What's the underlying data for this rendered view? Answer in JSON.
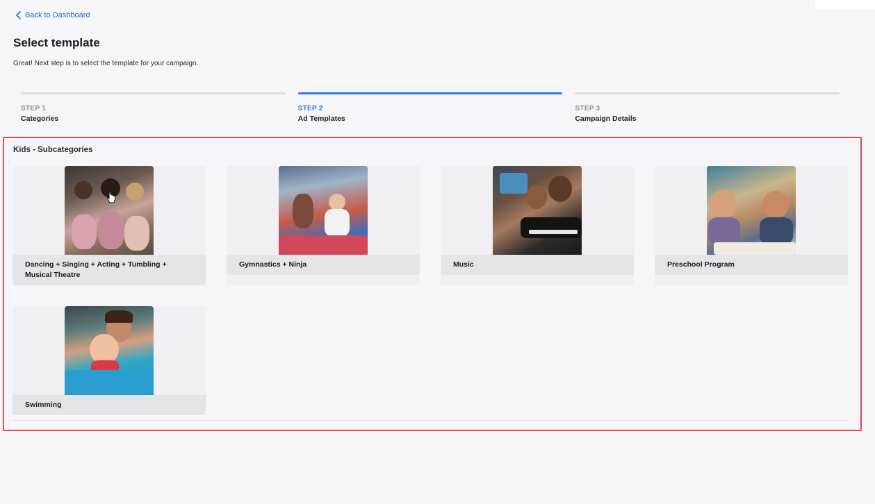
{
  "nav": {
    "back_label": "Back to Dashboard"
  },
  "header": {
    "title": "Select template",
    "subtitle": "Great! Next step is to select the template for your campaign."
  },
  "steps": [
    {
      "number": "STEP 1",
      "name": "Categories",
      "active": false
    },
    {
      "number": "STEP 2",
      "name": "Ad Templates",
      "active": true
    },
    {
      "number": "STEP 3",
      "name": "Campaign Details",
      "active": false
    }
  ],
  "section": {
    "title": "Kids - Subcategories",
    "cards": [
      {
        "label": "Dancing + Singing + Acting + Tumbling + Musical Theatre",
        "image": "kids-dancing-photo"
      },
      {
        "label": "Gymnastics + Ninja",
        "image": "kids-gymnastics-photo"
      },
      {
        "label": "Music",
        "image": "kids-piano-photo"
      },
      {
        "label": "Preschool Program",
        "image": "preschool-kids-photo"
      },
      {
        "label": "Swimming",
        "image": "toddler-swimming-photo"
      }
    ]
  },
  "colors": {
    "accent": "#2f7bd6",
    "highlight_border": "#e5484d",
    "link": "#1a6dcc"
  }
}
